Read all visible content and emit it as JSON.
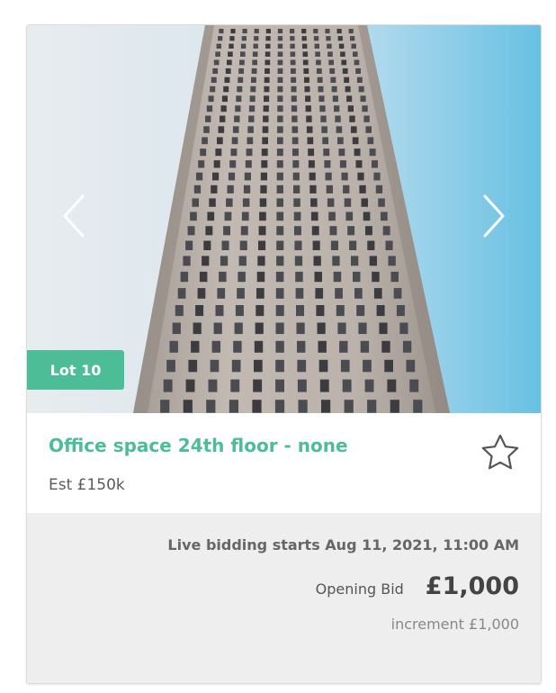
{
  "lot": {
    "badge": "Lot 10",
    "title": "Office space 24th floor - none",
    "estimate": "Est £150k"
  },
  "bidding": {
    "live_text": "Live bidding starts Aug 11, 2021, 11:00 AM",
    "opening_label": "Opening Bid",
    "opening_amount": "£1,000",
    "increment": "increment £1,000"
  },
  "icons": {
    "prev": "chevron-left-icon",
    "next": "chevron-right-icon",
    "favorite": "star-outline-icon"
  },
  "colors": {
    "accent": "#4dbd98",
    "sky_left": "#e6eaee",
    "sky_right": "#6ac2e3",
    "building": "#b9b0a9"
  }
}
